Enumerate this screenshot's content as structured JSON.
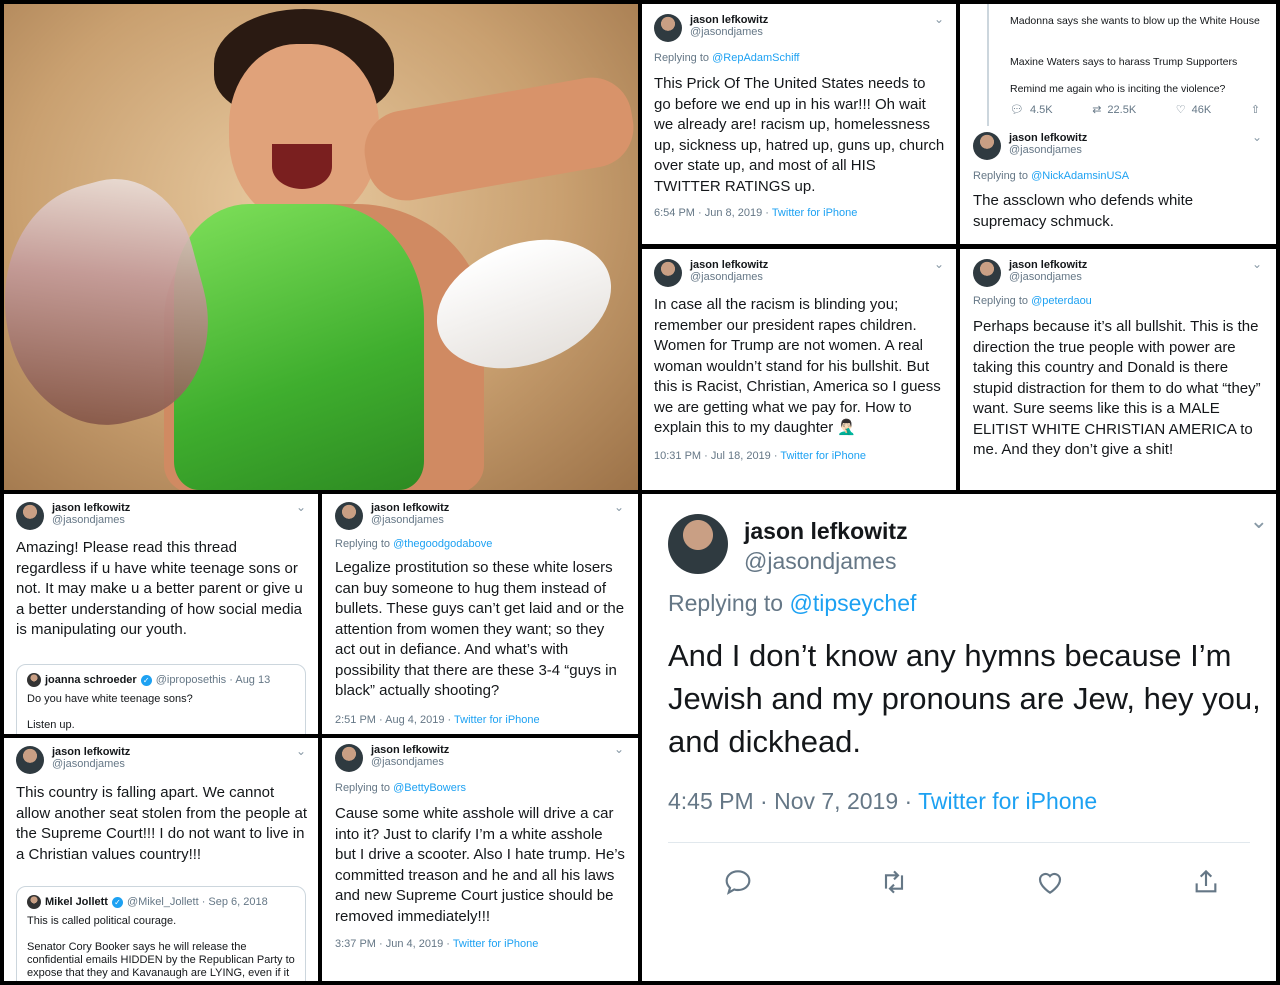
{
  "user": {
    "name": "jason lefkowitz",
    "handle": "@jasondjames"
  },
  "tweets": {
    "t1": {
      "replying_prefix": "Replying to ",
      "mention": "@RepAdamSchiff",
      "text": "This Prick Of The United States needs to go before we end up in his war!!!  Oh wait we already are!   racism up, homelessness up, sickness up, hatred up, guns up, church over state up, and most of all HIS TWITTER RATINGS up.",
      "time": "6:54 PM · Jun 8, 2019 · ",
      "source": "Twitter for iPhone"
    },
    "t2": {
      "prev_line1": "Madonna says she wants to blow up the White House",
      "prev_line2": "Maxine Waters says to harass Trump Supporters",
      "prev_line3": "Remind me again who is inciting the violence?",
      "replies": "4.5K",
      "retweets": "22.5K",
      "likes": "46K",
      "replying_prefix": "Replying to ",
      "mention": "@NickAdamsinUSA",
      "text": "The assclown who defends white supremacy schmuck."
    },
    "t3": {
      "text": "In case all the racism is blinding you; remember our president rapes children. Women for Trump are not women.  A real woman wouldn’t stand for his bullshit.  But this is Racist, Christian, America so I guess we are getting what we pay for.  How to explain this to my daughter 🤦🏻‍♂️",
      "time": "10:31 PM · Jul 18, 2019 · ",
      "source": "Twitter for iPhone"
    },
    "t4": {
      "replying_prefix": "Replying to ",
      "mention": "@peterdaou",
      "text": "Perhaps because it’s all bullshit.  This is the direction the true people with power are taking this country and Donald is there stupid distraction for them to do what “they” want.  Sure seems like  this is a MALE ELITIST WHITE CHRISTIAN AMERICA to me. And they don’t give a shit!"
    },
    "t5": {
      "text": "Amazing!  Please read this thread regardless if u have white teenage sons or not.  It may make u a better parent or give u a better understanding of how social media is manipulating our youth.",
      "quote_name": "joanna schroeder",
      "quote_handle": "@iproposethis · Aug 13",
      "quote_line1": "Do you have white teenage sons?",
      "quote_line2": "Listen up."
    },
    "t6": {
      "replying_prefix": "Replying to ",
      "mention": "@thegoodgodabove",
      "text": "Legalize prostitution so these white losers can buy someone to hug them instead of bullets.  These guys can’t get laid and or the attention from women they want; so they act out in defiance.  And what’s with possibility that there are these 3-4 “guys in black” actually shooting?",
      "time": "2:51 PM · Aug 4, 2019 · ",
      "source": "Twitter for iPhone"
    },
    "t7": {
      "text": "This country is falling apart. We cannot allow another seat stolen from the people at the Supreme Court!!!  I do not want to live in a Christian values country!!!",
      "quote_name": "Mikel Jollett",
      "quote_handle": "@Mikel_Jollett · Sep 6, 2018",
      "quote_line1": "This is called political courage.",
      "quote_line2": "Senator Cory Booker says he will release the confidential emails HIDDEN by the Republican Party to expose that they and Kavanaugh are LYING, even if it"
    },
    "t8": {
      "replying_prefix": "Replying to ",
      "mention": "@BettyBowers",
      "text": "Cause some white asshole will drive a car into it?  Just to clarify I’m a white asshole but I drive a scooter.  Also I  hate trump.  He’s committed treason and he and all his laws and new Supreme Court justice should be removed immediately!!!",
      "time": "3:37 PM · Jun 4, 2019 · ",
      "source": "Twitter for iPhone"
    },
    "t9": {
      "replying_prefix": "Replying to ",
      "mention": "@tipseychef",
      "text": "And I don’t know any hymns because I’m Jewish and my pronouns are Jew, hey you, and dickhead.",
      "time": "4:45 PM · Nov 7, 2019 · ",
      "source": "Twitter for iPhone"
    }
  },
  "icons": {
    "reply": "reply-icon",
    "retweet": "retweet-icon",
    "like": "heart-icon",
    "share": "share-icon",
    "more": "chevron-down-icon",
    "verified": "verified-badge-icon"
  },
  "colors": {
    "link": "#1da1f2",
    "secondary": "#657786",
    "text": "#14171a",
    "border": "#000000"
  }
}
